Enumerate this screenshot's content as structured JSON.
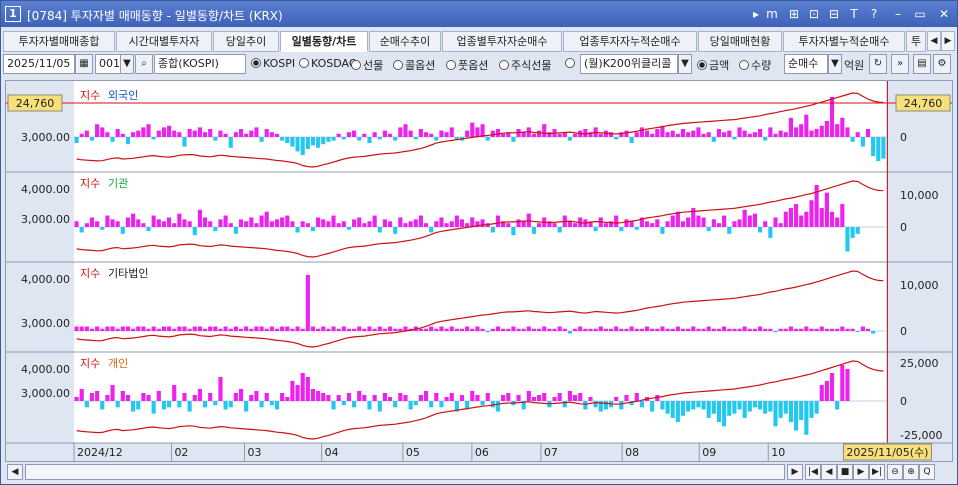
{
  "window": {
    "number": "1",
    "title": "[0784] 투자자별 매매동향 - 일별동향/차트 (KRX)",
    "title_buttons": [
      "▸",
      "m",
      "⊞",
      "⊡",
      "⊟",
      "T",
      "?",
      "–",
      "▭",
      "✕"
    ]
  },
  "tabs": [
    {
      "label": "투자자별매매종합",
      "active": false
    },
    {
      "label": "시간대별투자자",
      "active": false
    },
    {
      "label": "당일추이",
      "active": false
    },
    {
      "label": "일별동향/차트",
      "active": true
    },
    {
      "label": "순매수추이",
      "active": false
    },
    {
      "label": "업종별투자자순매수",
      "active": false
    },
    {
      "label": "업종투자자누적순매수",
      "active": false
    },
    {
      "label": "당일매매현황",
      "active": false
    },
    {
      "label": "투자자별누적순매수",
      "active": false
    },
    {
      "label": "투",
      "active": false
    }
  ],
  "toolbar": {
    "date": "2025/11/05",
    "code": "001",
    "index_name": "종합(KOSPI)",
    "markets": [
      {
        "label": "KOSPI",
        "checked": true
      },
      {
        "label": "KOSDAQ",
        "checked": false
      },
      {
        "label": "선물",
        "checked": false
      },
      {
        "label": "콜옵션",
        "checked": false
      },
      {
        "label": "풋옵션",
        "checked": false
      },
      {
        "label": "주식선물",
        "checked": false
      },
      {
        "label": "",
        "checked": false
      }
    ],
    "product_select": "(월)K200위클리콜",
    "units": [
      {
        "label": "금액",
        "checked": true
      },
      {
        "label": "수량",
        "checked": false
      }
    ],
    "type_select": "순매수",
    "unit_text": "억원"
  },
  "colors": {
    "positive": "#ee22ee",
    "negative": "#22c8ee",
    "index_line": "#cc1111",
    "grid": "#8e9bb5"
  },
  "chart_data": {
    "type": "bar",
    "x_start": "2024/12",
    "x_end": "2025/11/05",
    "month_ticks": [
      "2024/12",
      "02",
      "03",
      "04",
      "05",
      "06",
      "07",
      "08",
      "09",
      "10",
      "/05"
    ],
    "crosshair_label": "2025/11/05(수)",
    "crosshair_value": "24,760",
    "series": [
      {
        "name": "외국인",
        "index_label": "지수",
        "left_ticks": [
          "3,000.00"
        ],
        "right_ticks": [
          "0"
        ],
        "values": [
          -5,
          2,
          4,
          -3,
          8,
          6,
          3,
          -4,
          5,
          2,
          -6,
          3,
          4,
          6,
          8,
          -2,
          4,
          6,
          7,
          4,
          3,
          -8,
          5,
          4,
          6,
          3,
          5,
          -3,
          4,
          2,
          -9,
          3,
          5,
          2,
          4,
          6,
          -4,
          5,
          3,
          2,
          -3,
          -5,
          -8,
          -12,
          -15,
          -10,
          -7,
          -9,
          -6,
          -4,
          -3,
          2,
          -2,
          3,
          4,
          -3,
          2,
          -5,
          3,
          -2,
          4,
          2,
          -3,
          6,
          8,
          4,
          -2,
          5,
          3,
          2,
          -3,
          4,
          3,
          6,
          -2,
          -3,
          4,
          9,
          6,
          8,
          -3,
          4,
          5,
          2,
          3,
          -4,
          5,
          3,
          6,
          2,
          4,
          8,
          3,
          5,
          2,
          3,
          -3,
          2,
          4,
          5,
          3,
          6,
          2,
          4,
          3,
          -2,
          3,
          4,
          -5,
          3,
          6,
          4,
          2,
          5,
          7,
          3,
          4,
          2,
          5,
          3,
          4,
          6,
          2,
          3,
          -4,
          5,
          3,
          4,
          -2,
          6,
          4,
          2,
          3,
          5,
          -3,
          6,
          2,
          4,
          3,
          12,
          6,
          8,
          14,
          4,
          5,
          7,
          10,
          25,
          8,
          12,
          6,
          -4,
          3,
          -8,
          5,
          -16,
          -20,
          -18
        ],
        "index_values": [
          2500,
          2480,
          2470,
          2460,
          2450,
          2455,
          2490,
          2520,
          2530,
          2500,
          2510,
          2520,
          2540,
          2560,
          2580,
          2590,
          2570,
          2560,
          2550,
          2570,
          2600,
          2610,
          2620,
          2610,
          2580,
          2570,
          2560,
          2580,
          2600,
          2590,
          2570,
          2560,
          2550,
          2540,
          2530,
          2520,
          2510,
          2500,
          2480,
          2460,
          2450,
          2430,
          2410,
          2380,
          2330,
          2300,
          2290,
          2310,
          2350,
          2380,
          2420,
          2460,
          2500,
          2530,
          2550,
          2560,
          2570,
          2590,
          2610,
          2630,
          2640,
          2650,
          2660,
          2680,
          2700,
          2720,
          2750,
          2780,
          2820,
          2870,
          2920,
          2950,
          2970,
          2990,
          3010,
          3030,
          3050,
          3070,
          3090,
          3110,
          3120,
          3140,
          3160,
          3180,
          3190,
          3190,
          3200,
          3210,
          3220,
          3200,
          3190,
          3180,
          3170,
          3180,
          3190,
          3200,
          3210,
          3190,
          3170,
          3160,
          3180,
          3200,
          3190,
          3180,
          3170,
          3160,
          3170,
          3190,
          3210,
          3230,
          3260,
          3290,
          3310,
          3330,
          3350,
          3380,
          3400,
          3420,
          3440,
          3450,
          3460,
          3470,
          3480,
          3490,
          3500,
          3510,
          3520,
          3530,
          3540,
          3560,
          3580,
          3600,
          3620,
          3640,
          3670,
          3700,
          3720,
          3750,
          3780,
          3800,
          3830,
          3860,
          3890,
          3920,
          3960,
          4000,
          4040,
          4080,
          4120,
          4160,
          4200,
          4240,
          4230,
          4150,
          4080,
          4030,
          4000,
          3990
        ]
      },
      {
        "name": "기관",
        "index_label": "지수",
        "left_ticks": [
          "4,000.00",
          "3,000.00"
        ],
        "right_ticks": [
          "10,000",
          "0"
        ],
        "values": [
          3,
          -4,
          2,
          5,
          3,
          -2,
          6,
          4,
          3,
          -5,
          5,
          7,
          4,
          2,
          -3,
          6,
          4,
          3,
          5,
          2,
          7,
          4,
          3,
          -6,
          9,
          5,
          3,
          -3,
          4,
          6,
          2,
          -5,
          4,
          3,
          5,
          2,
          6,
          8,
          3,
          4,
          5,
          6,
          3,
          -4,
          3,
          2,
          -3,
          5,
          4,
          3,
          6,
          2,
          3,
          -2,
          4,
          5,
          2,
          3,
          6,
          -4,
          4,
          3,
          -5,
          5,
          2,
          3,
          4,
          6,
          2,
          -4,
          3,
          5,
          2,
          3,
          6,
          4,
          2,
          5,
          3,
          4,
          2,
          -4,
          6,
          3,
          2,
          -6,
          4,
          3,
          7,
          -5,
          2,
          5,
          3,
          2,
          -4,
          6,
          3,
          2,
          5,
          4,
          3,
          -3,
          5,
          2,
          3,
          6,
          -3,
          4,
          3,
          -2,
          5,
          3,
          2,
          4,
          -5,
          3,
          6,
          8,
          3,
          5,
          10,
          6,
          5,
          -3,
          4,
          2,
          6,
          -5,
          3,
          4,
          9,
          6,
          7,
          -4,
          3,
          -8,
          5,
          2,
          8,
          10,
          12,
          6,
          8,
          14,
          22,
          10,
          18,
          8,
          5,
          12,
          -18,
          -8,
          -5
        ]
      },
      {
        "name": "기타법인",
        "index_label": "지수",
        "left_ticks": [
          "4,000.00",
          "3,000.00"
        ],
        "right_ticks": [
          "10,000",
          "0"
        ],
        "values": [
          2,
          2,
          2,
          1,
          2,
          1,
          2,
          2,
          1,
          2,
          2,
          1,
          2,
          2,
          1,
          2,
          1,
          2,
          2,
          1,
          2,
          2,
          1,
          2,
          2,
          1,
          2,
          2,
          1,
          2,
          1,
          2,
          1,
          2,
          1,
          2,
          2,
          1,
          2,
          1,
          2,
          2,
          1,
          2,
          1,
          25,
          2,
          1,
          2,
          1,
          2,
          1,
          2,
          1,
          1,
          2,
          1,
          2,
          1,
          2,
          1,
          2,
          1,
          1,
          2,
          1,
          2,
          1,
          1,
          2,
          1,
          2,
          1,
          2,
          1,
          1,
          2,
          1,
          2,
          1,
          -2,
          1,
          2,
          1,
          1,
          2,
          1,
          1,
          2,
          1,
          1,
          2,
          1,
          1,
          2,
          1,
          -4,
          1,
          2,
          1,
          1,
          1,
          2,
          1,
          1,
          2,
          1,
          1,
          2,
          1,
          1,
          2,
          1,
          1,
          2,
          1,
          1,
          2,
          1,
          1,
          2,
          1,
          1,
          2,
          1,
          1,
          2,
          1,
          1,
          1,
          2,
          1,
          1,
          2,
          1,
          1,
          -2,
          1,
          1,
          2,
          1,
          1,
          2,
          1,
          1,
          2,
          1,
          1,
          1,
          2,
          1,
          1,
          -1,
          2,
          1,
          -4
        ]
      },
      {
        "name": "개인",
        "index_label": "지수",
        "left_ticks": [
          "4,000.00",
          "3,000.00"
        ],
        "right_ticks": [
          "25,000",
          "0",
          "-25,000"
        ],
        "values": [
          2,
          6,
          -3,
          4,
          5,
          -4,
          3,
          8,
          -3,
          5,
          3,
          -5,
          -4,
          4,
          3,
          -6,
          5,
          -4,
          -3,
          8,
          -3,
          4,
          -5,
          3,
          6,
          -3,
          4,
          -2,
          12,
          -4,
          -3,
          4,
          6,
          -5,
          3,
          5,
          -3,
          4,
          -2,
          -4,
          4,
          2,
          10,
          8,
          14,
          12,
          6,
          5,
          4,
          3,
          -4,
          3,
          -2,
          4,
          -3,
          5,
          3,
          -4,
          3,
          -5,
          4,
          2,
          -3,
          4,
          3,
          -4,
          -2,
          3,
          5,
          -3,
          4,
          -3,
          2,
          4,
          -5,
          3,
          -4,
          5,
          3,
          -2,
          4,
          -3,
          -5,
          3,
          4,
          -2,
          3,
          -4,
          5,
          2,
          3,
          4,
          -3,
          2,
          4,
          -3,
          5,
          3,
          4,
          -4,
          2,
          -3,
          -5,
          -4,
          -3,
          2,
          -4,
          3,
          -2,
          4,
          -3,
          2,
          -5,
          3,
          -4,
          -6,
          -8,
          -10,
          -7,
          -5,
          -4,
          -3,
          -4,
          -8,
          -6,
          -10,
          -12,
          -7,
          -6,
          -4,
          -8,
          -5,
          -3,
          -4,
          -6,
          -5,
          -12,
          -8,
          -6,
          -10,
          -14,
          -9,
          -16,
          -8,
          -6,
          8,
          10,
          14,
          -4,
          18,
          16
        ]
      }
    ]
  },
  "scrollbar": {
    "buttons": [
      "◀",
      "▶",
      "|◀",
      "◀",
      "■",
      "▶",
      "▶|",
      "⊖",
      "⊕",
      "Q"
    ]
  }
}
